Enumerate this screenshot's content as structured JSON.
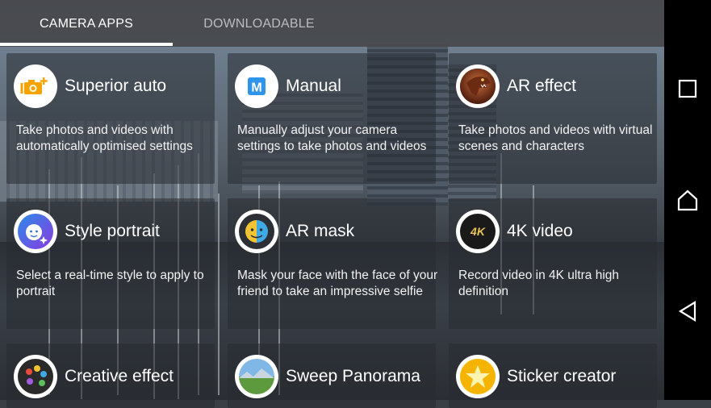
{
  "tabs": {
    "camera_apps": "CAMERA APPS",
    "downloadable": "DOWNLOADABLE"
  },
  "apps": [
    {
      "name": "Superior auto",
      "description": "Take photos and videos with automatically optimised settings"
    },
    {
      "name": "Manual",
      "description": "Manually adjust your camera settings to take photos and videos"
    },
    {
      "name": "AR effect",
      "description": "Take photos and videos with virtual scenes and characters"
    },
    {
      "name": "Style portrait",
      "description": "Select a real-time style to apply to portrait"
    },
    {
      "name": "AR mask",
      "description": "Mask your face with the face of your friend to take an impressive selfie"
    },
    {
      "name": "4K video",
      "description": "Record video in 4K ultra high definition"
    },
    {
      "name": "Creative effect",
      "description": ""
    },
    {
      "name": "Sweep Panorama",
      "description": ""
    },
    {
      "name": "Sticker creator",
      "description": ""
    }
  ],
  "manual_icon_letter": "M",
  "video_icon_text": "4K",
  "icons": {
    "superior_auto": "camera-plus-icon",
    "manual": "manual-m-icon",
    "ar_effect": "dinosaur-icon",
    "style_portrait": "face-sparkle-icon",
    "ar_mask": "mask-icon",
    "video_4k": "4k-icon",
    "creative_effect": "palette-icon",
    "sweep_panorama": "panorama-icon",
    "sticker_creator": "star-sticker-icon"
  },
  "nav": {
    "recents": "square-icon",
    "home": "home-icon",
    "back": "back-triangle-icon"
  },
  "colors": {
    "tab_bar": "#46484c",
    "nav_bar": "#000000",
    "manual_icon_blue": "#2f95e8",
    "icon_ring": "#ffffff"
  }
}
